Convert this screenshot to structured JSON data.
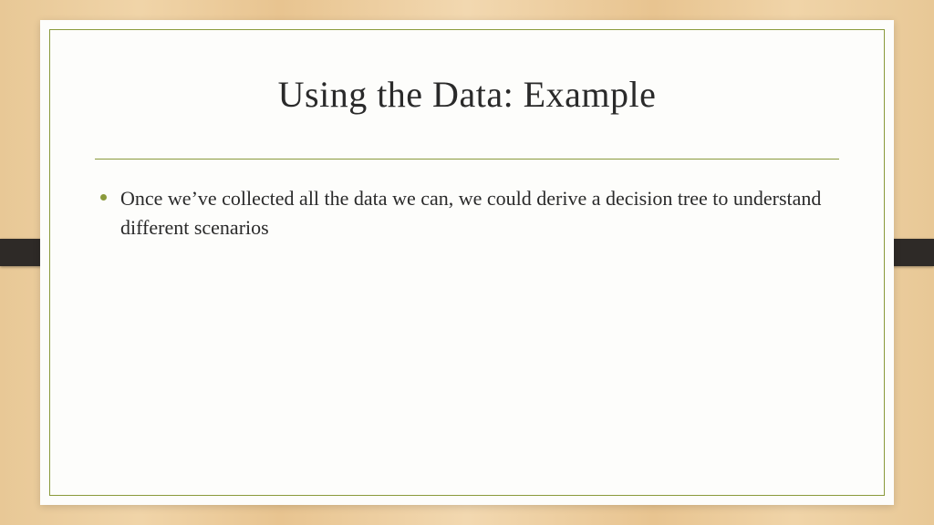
{
  "slide": {
    "title": "Using the Data: Example",
    "bullets": [
      "Once we’ve collected all the data we can, we could derive a decision tree to understand different scenarios"
    ]
  },
  "colors": {
    "accent": "#8a9a3b",
    "text": "#2a2a2a",
    "background_wood": "#e8c896",
    "slide_bg": "#fdfdfb",
    "clasp": "#2e2a27"
  }
}
